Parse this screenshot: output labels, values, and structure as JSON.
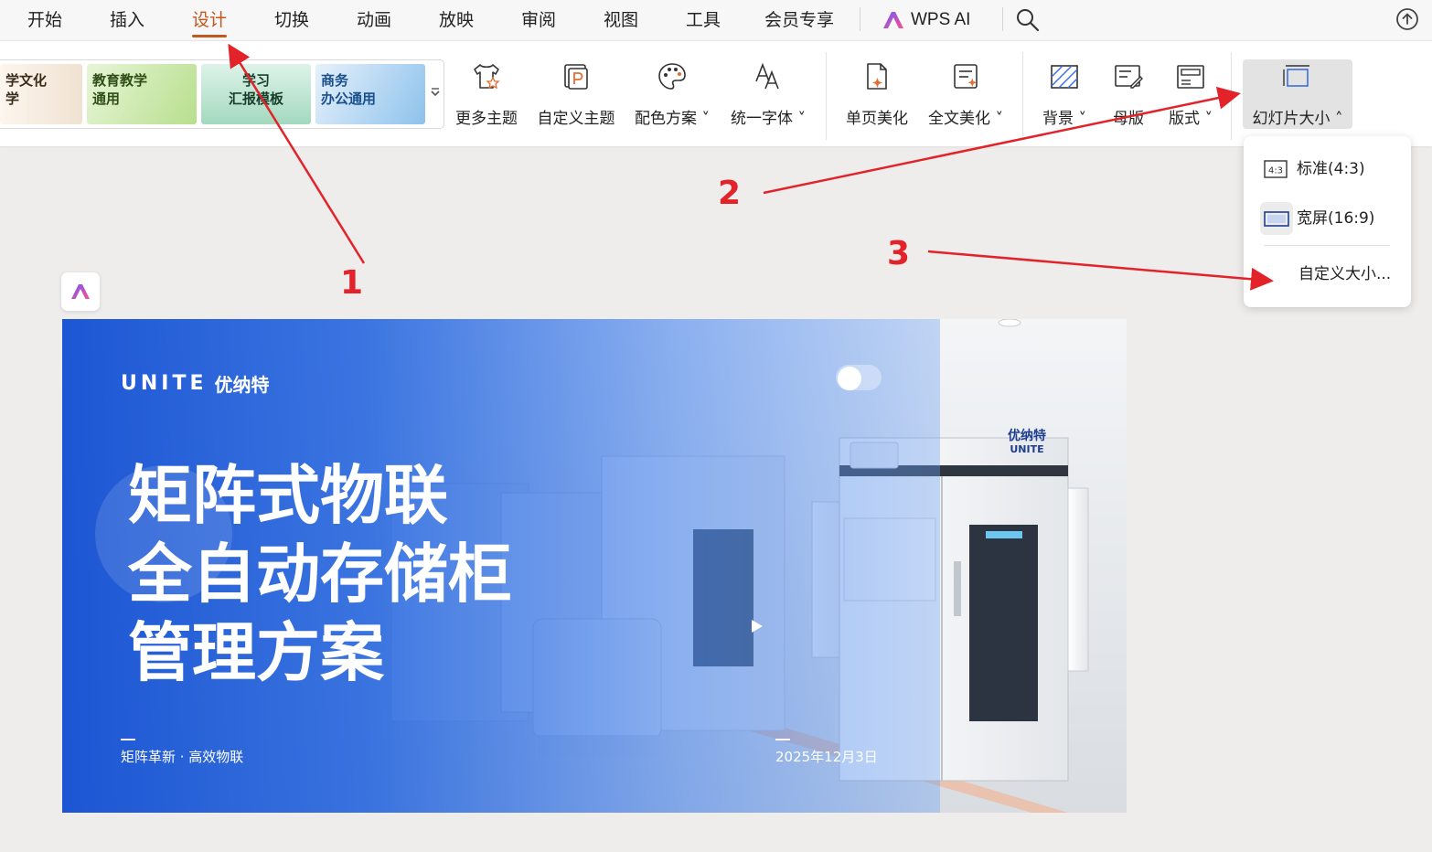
{
  "menubar": {
    "tabs": [
      {
        "label": "开始"
      },
      {
        "label": "插入"
      },
      {
        "label": "设计"
      },
      {
        "label": "切换"
      },
      {
        "label": "动画"
      },
      {
        "label": "放映"
      },
      {
        "label": "审阅"
      },
      {
        "label": "视图"
      },
      {
        "label": "工具"
      },
      {
        "label": "会员专享"
      }
    ],
    "active_tab": "设计",
    "wps_ai_label": "WPS AI",
    "accent_color": "#c4571c"
  },
  "ribbon": {
    "themes": [
      {
        "label": "学文化\n学"
      },
      {
        "label": "教育教学\n通用"
      },
      {
        "label": "学习\n汇报模板"
      },
      {
        "label": "商务\n办公通用"
      }
    ],
    "buttons": {
      "more_themes": "更多主题",
      "custom_theme": "自定义主题",
      "color_scheme": "配色方案",
      "unify_font": "统一字体",
      "single_page_beautify": "单页美化",
      "full_beautify": "全文美化",
      "background": "背景",
      "master": "母版",
      "layout": "版式",
      "slide_size": "幻灯片大小"
    }
  },
  "dropdown": {
    "items": [
      {
        "label": "标准(4:3)",
        "icon": "4:3"
      },
      {
        "label": "宽屏(16:9)"
      },
      {
        "label": "自定义大小..."
      }
    ]
  },
  "slide": {
    "logo_en": "UNITE",
    "logo_cn": "优纳特",
    "title_lines": [
      "矩阵式物联",
      "全自动存储柜",
      "管理方案"
    ],
    "subtitle": "矩阵革新 · 高效物联",
    "date": "2025年12月3日",
    "machine_logo_cn": "优纳特",
    "machine_logo_en": "UNITE",
    "overlay_color": "#1450d2"
  },
  "annotations": {
    "numbers": [
      "1",
      "2",
      "3"
    ],
    "color": "#e2232a"
  }
}
